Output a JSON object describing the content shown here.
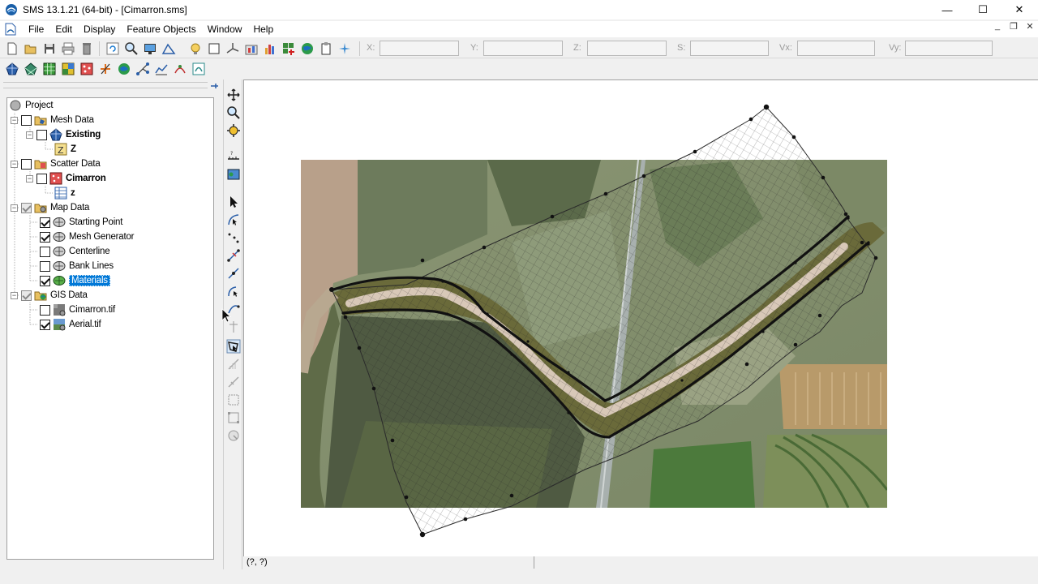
{
  "window": {
    "title": "SMS 13.1.21 (64-bit) - [Cimarron.sms]",
    "minimize_glyph": "—",
    "maximize_glyph": "☐",
    "close_glyph": "✕"
  },
  "menu": {
    "items": [
      "File",
      "Edit",
      "Display",
      "Feature Objects",
      "Window",
      "Help"
    ],
    "mdi_minimize": "_",
    "mdi_restore": "❐",
    "mdi_close": "✕"
  },
  "coords": {
    "x_label": "X:",
    "y_label": "Y:",
    "z_label": "Z:",
    "s_label": "S:",
    "vx_label": "Vx:",
    "vy_label": "Vy:",
    "x_value": "",
    "y_value": "",
    "z_value": "",
    "s_value": "",
    "vx_value": "",
    "vy_value": ""
  },
  "tree": {
    "project": "Project",
    "mesh_data": "Mesh Data",
    "existing": "Existing",
    "mesh_z": "Z",
    "scatter_data": "Scatter Data",
    "cimarron": "Cimarron",
    "scatter_z": "z",
    "map_data": "Map Data",
    "starting_point": "Starting Point",
    "mesh_generator": "Mesh Generator",
    "centerline": "Centerline",
    "bank_lines": "Bank Lines",
    "materials": "Materials",
    "gis_data": "GIS Data",
    "cimarron_tif": "Cimarron.tif",
    "aerial_tif": "Aerial.tif",
    "checked": {
      "mesh_data": false,
      "existing": false,
      "scatter_data": false,
      "cimarron": false,
      "map_data": "partial",
      "starting_point": true,
      "mesh_generator": true,
      "centerline": false,
      "bank_lines": false,
      "materials": true,
      "gis_data": "partial",
      "cimarron_tif": false,
      "aerial_tif": true
    }
  },
  "status": {
    "coords": "(?, ?)"
  },
  "colors": {
    "selection": "#0078d7",
    "mesh_line": "#2a2a2a",
    "bank_line": "#111111",
    "aerial_field": "#7f8c66",
    "aerial_tree": "#3d4a33"
  }
}
